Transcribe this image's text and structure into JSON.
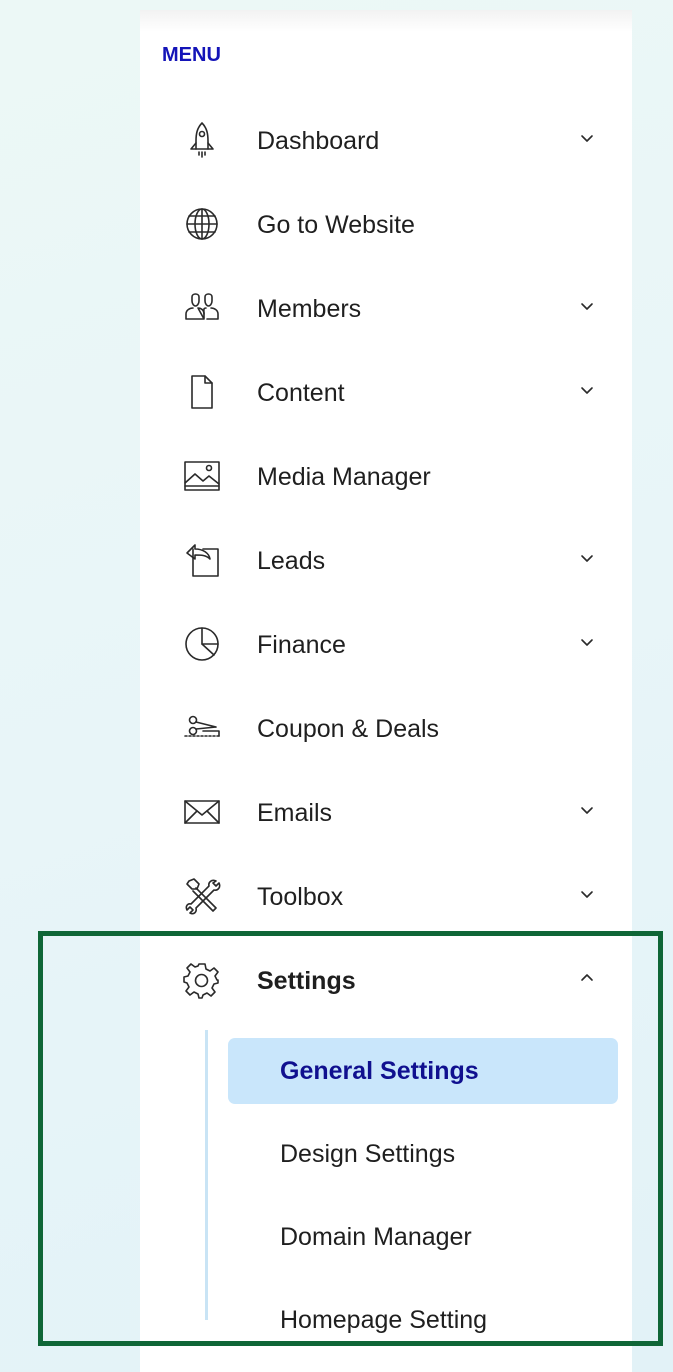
{
  "menu": {
    "heading": "MENU",
    "items": [
      {
        "label": "Dashboard",
        "icon": "rocket-icon",
        "has_chevron": true
      },
      {
        "label": "Go to Website",
        "icon": "globe-icon",
        "has_chevron": false
      },
      {
        "label": "Members",
        "icon": "users-icon",
        "has_chevron": true
      },
      {
        "label": "Content",
        "icon": "document-icon",
        "has_chevron": true
      },
      {
        "label": "Media Manager",
        "icon": "image-icon",
        "has_chevron": false
      },
      {
        "label": "Leads",
        "icon": "leads-icon",
        "has_chevron": true
      },
      {
        "label": "Finance",
        "icon": "pie-chart-icon",
        "has_chevron": true
      },
      {
        "label": "Coupon & Deals",
        "icon": "coupon-icon",
        "has_chevron": false
      },
      {
        "label": "Emails",
        "icon": "envelope-icon",
        "has_chevron": true
      },
      {
        "label": "Toolbox",
        "icon": "tools-icon",
        "has_chevron": true
      },
      {
        "label": "Settings",
        "icon": "gear-icon",
        "has_chevron": true,
        "expanded": true
      }
    ],
    "settings_submenu": [
      {
        "label": "General Settings",
        "active": true
      },
      {
        "label": "Design Settings",
        "active": false
      },
      {
        "label": "Domain Manager",
        "active": false
      },
      {
        "label": "Homepage Setting",
        "active": false
      }
    ]
  },
  "colors": {
    "heading": "#1414b8",
    "active_bg": "#c9e6fb",
    "active_text": "#10108f",
    "highlight_border": "#0f6637",
    "submenu_line": "#c9e4f5"
  }
}
